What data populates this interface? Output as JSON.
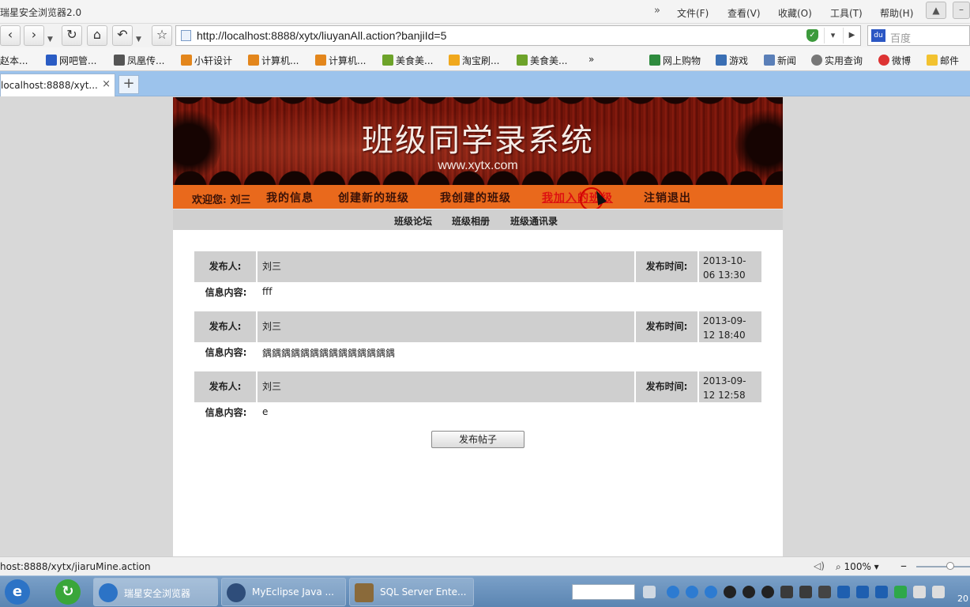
{
  "browser": {
    "app_title": "瑞星安全浏览器2.0",
    "chevron": "»",
    "menu": [
      "文件(F)",
      "查看(V)",
      "收藏(O)",
      "工具(T)",
      "帮助(H)"
    ],
    "url": "http://localhost:8888/xytx/liuyanAll.action?banjiId=5",
    "search_placeholder": "百度",
    "bookmarks": [
      "赵本...",
      "网吧管...",
      "凤凰传...",
      "小轩设计",
      "计算机...",
      "计算机...",
      "美食美...",
      "淘宝刷...",
      "美食美...",
      "»",
      "网上购物",
      "游戏",
      "新闻",
      "实用查询",
      "微博",
      "邮件"
    ],
    "tab_title": "localhost:8888/xyt...",
    "tab_close": "×",
    "new_tab": "+",
    "status_url": "host:8888/xytx/jiaruMine.action",
    "zoom": "100%"
  },
  "site": {
    "banner_title": "班级同学录系统",
    "banner_url": "www.xytx.com",
    "welcome": "欢迎您: 刘三",
    "nav": [
      "我的信息",
      "创建新的班级",
      "我创建的班级",
      "我加入的班级",
      "注销退出"
    ],
    "active_nav_index": 3,
    "subnav": [
      "班级论坛",
      "班级相册",
      "班级通讯录"
    ]
  },
  "labels": {
    "poster": "发布人:",
    "time": "发布时间:",
    "content": "信息内容:"
  },
  "posts": [
    {
      "poster": "刘三",
      "time_date": "2013-10-",
      "time_rest": "06 13:30",
      "content": "fff"
    },
    {
      "poster": "刘三",
      "time_date": "2013-09-",
      "time_rest": "12 18:40",
      "content": "鍝鍝鍝鍝鍝鍝鍝鍝鍝鍝鍝鍝鍝鍝"
    },
    {
      "poster": "刘三",
      "time_date": "2013-09-",
      "time_rest": "12 12:58",
      "content": "e"
    }
  ],
  "publish_button": "发布帖子",
  "taskbar": {
    "tasks": [
      "瑞星安全浏览器",
      "MyEclipse Java ...",
      "SQL Server Ente..."
    ],
    "clock": "20"
  },
  "colors": {
    "nav_orange": "#e9691c",
    "active_link": "#d11111",
    "tab_bar": "#9cc3ec",
    "post_header_gray": "#cfcfcf"
  }
}
